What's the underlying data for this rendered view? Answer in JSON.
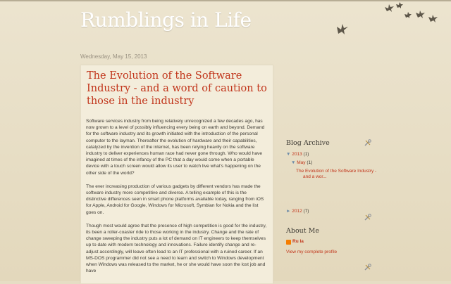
{
  "header": {
    "blog_title": "Rumblings in Life"
  },
  "post": {
    "date": "Wednesday, May 15, 2013",
    "title": "The Evolution of the Software Industry - and a word of caution to those in the industry",
    "paragraphs": [
      "Software services industry from being relatively unrecognized a few decades ago, has now grown to a level of possibly influencing every being on earth and beyond. Demand for the software industry and its growth initiated with the introduction of the personal computer to the layman. Thereafter the evolution of hardware and their capabilities, catalyzed by the invention of the internet, has been relying heavily on the software industry to deliver experiences human race had never gone through. Who would have imagined at times of the infancy of the PC that a day would come when a portable device with a touch screen would allow its user to watch live what's happening on the other side of the world?",
      "The ever increasing production of various gadgets by different vendors has made the software industry more competitive and diverse. A telling example of this is the distinctive differences seen in smart phone platforms available today, ranging from iOS for Apple, Android for Google, Windows for Microsoft, Symbian for Nokia and the list goes on.",
      "Though most would agree that the presence of high competition is good for the industry, its been a roller-coaster ride to those working in the industry. Change and the rate of change sweeping the industry puts a lot of demand on IT engineers to keep themselves up to date with modern technology and innovations. Failure identify change and re-adjust accordingly, will leave often lead to an IT professional with a ruined career. If an MS-DOS programmer did not see a need to learn and switch to Windows development when Windows was released to the market, he or she would have soon the lost job and have"
    ]
  },
  "sidebar": {
    "archive": {
      "title": "Blog Archive",
      "years": [
        {
          "toggle": "▼",
          "label": "2013",
          "count": "(1)"
        },
        {
          "toggle": "►",
          "label": "2012",
          "count": "(7)"
        }
      ],
      "month": {
        "toggle": "▼",
        "label": "May",
        "count": "(1)"
      },
      "post_link_line1": "The Evolution of the Software Industry -",
      "post_link_line2": "and a wor..."
    },
    "about": {
      "title": "About Me",
      "author": "Ru la",
      "profile_link": "View my complete profile"
    }
  },
  "icons": {
    "edit": "wrench-screwdriver-icon",
    "blogger": "blogger-icon"
  },
  "colors": {
    "link": "#c1351b",
    "title": "#ffffff",
    "background": "#e6ddc4"
  }
}
